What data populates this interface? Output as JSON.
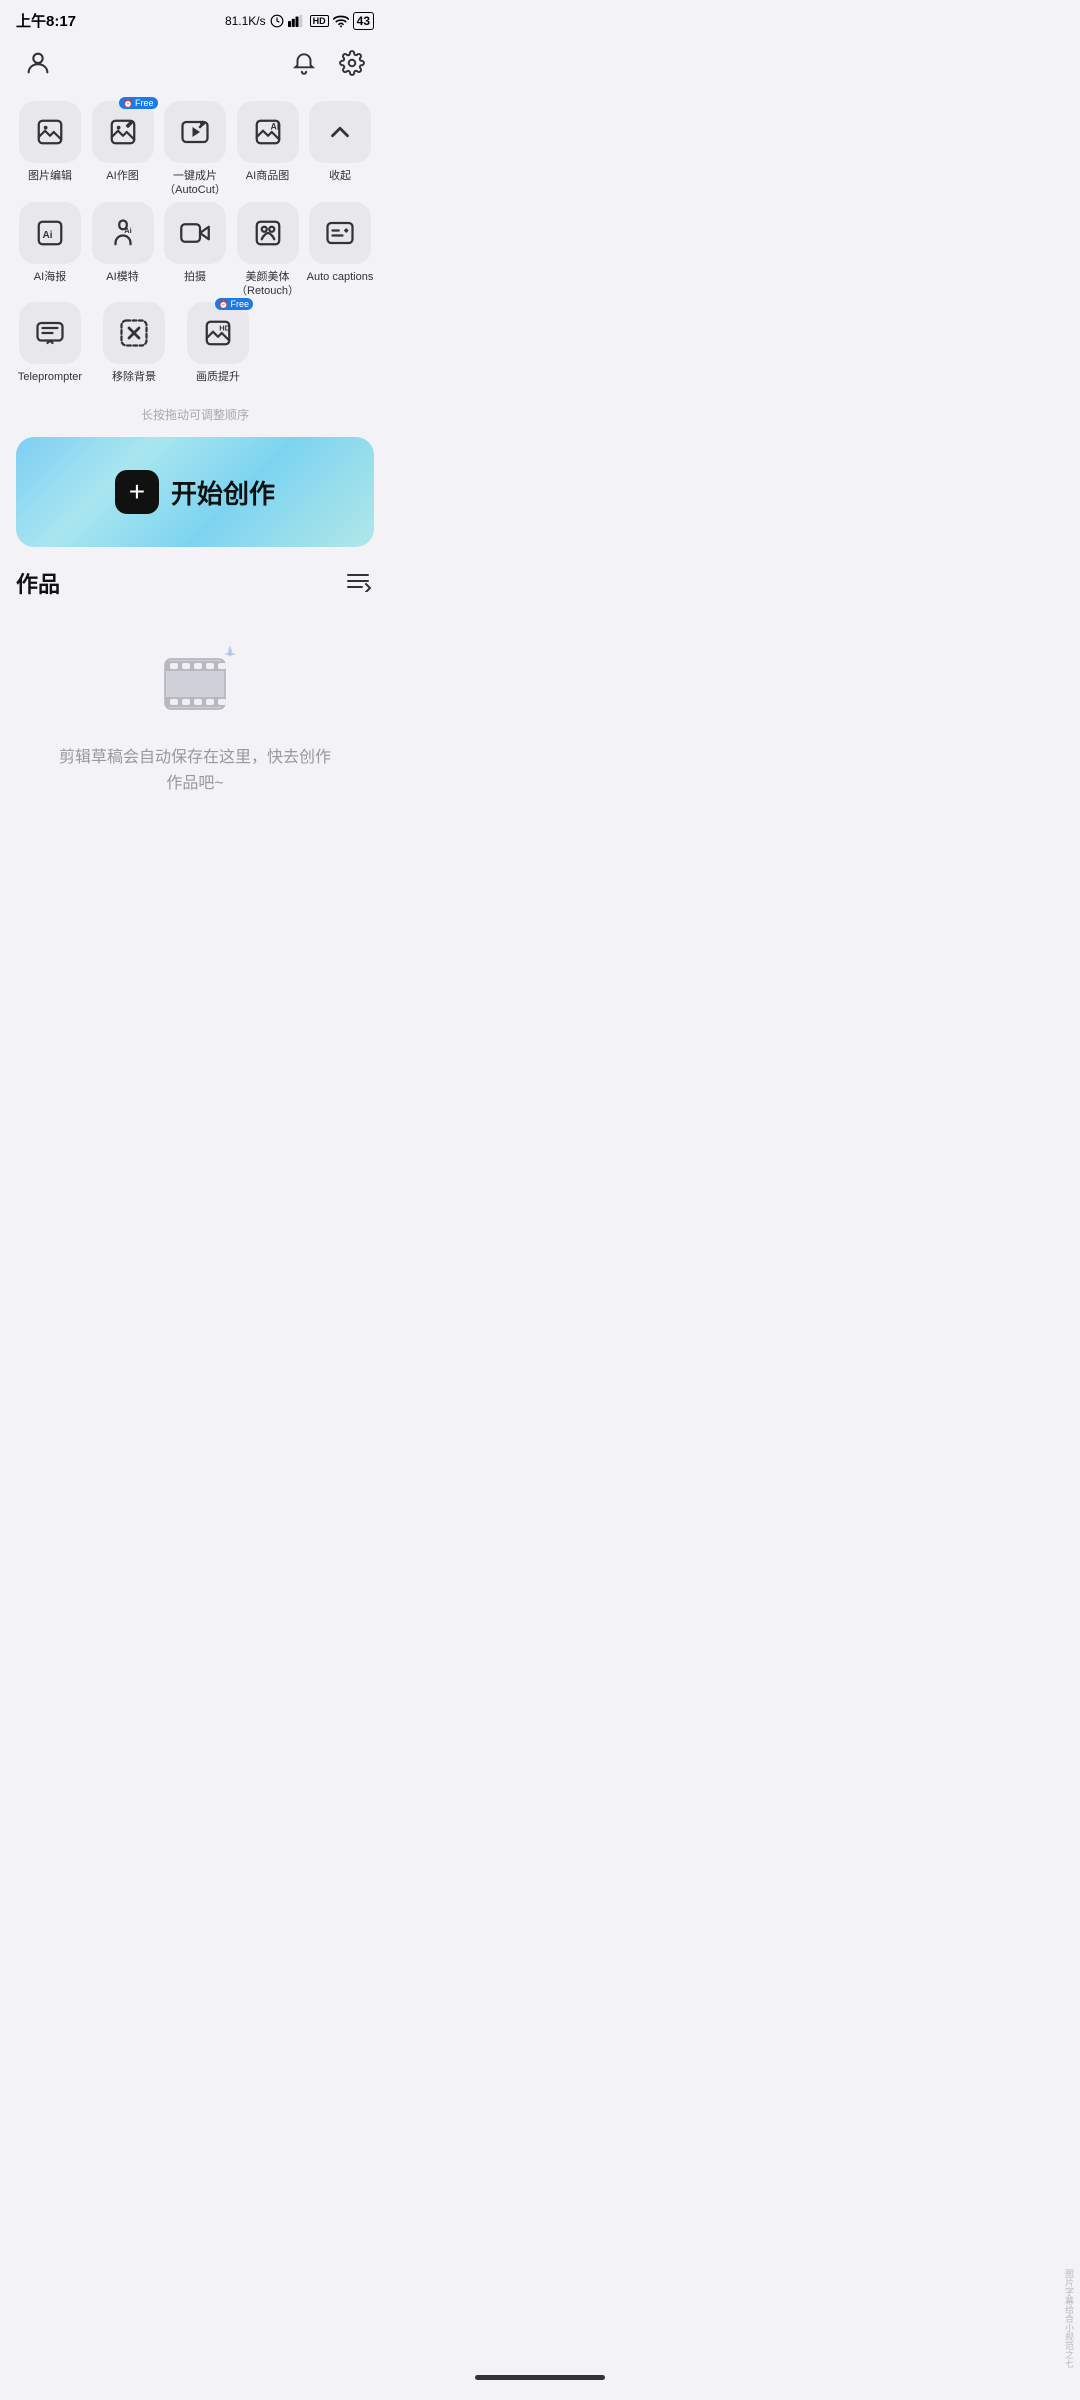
{
  "statusBar": {
    "time": "上午8:17",
    "speed": "81.1K/s",
    "battery": "43"
  },
  "nav": {
    "profileIcon": "person",
    "bellIcon": "bell",
    "settingsIcon": "settings"
  },
  "toolsRows": [
    [
      {
        "id": "imgEdit",
        "label": "图片编辑",
        "free": false
      },
      {
        "id": "aiDraw",
        "label": "AI作图",
        "free": true
      },
      {
        "id": "autocut",
        "label": "一键成片\n（AutoCut）",
        "free": false
      },
      {
        "id": "aiProduct",
        "label": "AI商品图",
        "free": false
      },
      {
        "id": "collapse",
        "label": "收起",
        "free": false,
        "isCollapse": true
      }
    ],
    [
      {
        "id": "aiPoster",
        "label": "AI海报",
        "free": false
      },
      {
        "id": "aiModel",
        "label": "AI模特",
        "free": false
      },
      {
        "id": "camera",
        "label": "拍摄",
        "free": false
      },
      {
        "id": "retouch",
        "label": "美颜美体\n（Retouch）",
        "free": false
      },
      {
        "id": "captions",
        "label": "Auto captions",
        "free": false
      }
    ],
    [
      {
        "id": "teleprompter",
        "label": "Teleprompter",
        "free": false
      },
      {
        "id": "removeBg",
        "label": "移除背景",
        "free": false
      },
      {
        "id": "enhance",
        "label": "画质提升",
        "free": true
      }
    ]
  ],
  "dragHint": "长按拖动可调整顺序",
  "startCreate": {
    "label": "开始创作",
    "plusLabel": "+"
  },
  "worksSection": {
    "title": "作品",
    "emptyText": "剪辑草稿会自动保存在这里，快去创作\n作品吧~"
  },
  "watermark": "图片字幕给合小规范之七"
}
